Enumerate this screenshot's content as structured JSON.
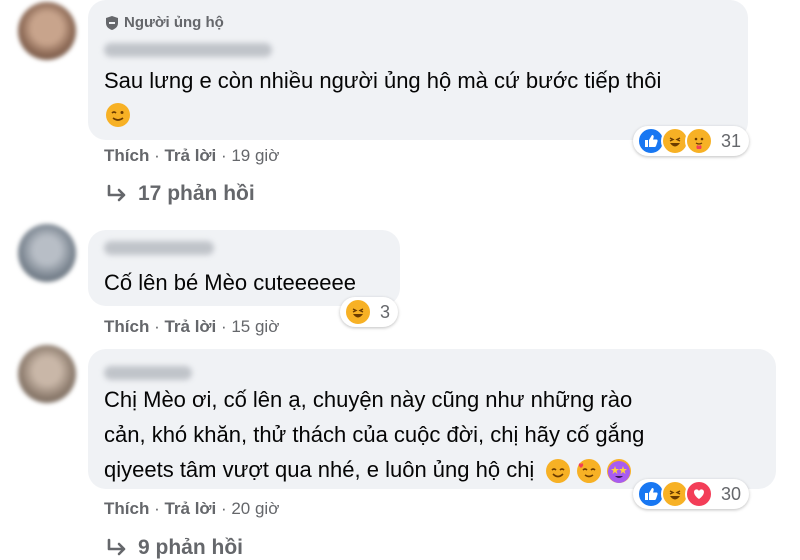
{
  "comments": [
    {
      "badge": "Người ủng hộ",
      "text_line1": "Sau lưng e còn nhiều người ủng hộ mà cứ bước tiếp thôi",
      "reaction_count": "31",
      "actions": {
        "like": "Thích",
        "sep1": " · ",
        "reply": "Trả lời",
        "sep2": " · ",
        "time": "19 giờ"
      },
      "replies": "17 phản hồi"
    },
    {
      "text": "Cố lên bé Mèo cuteeeeee",
      "reaction_count": "3",
      "actions": {
        "like": "Thích",
        "sep1": " · ",
        "reply": "Trả lời",
        "sep2": " · ",
        "time": "15 giờ"
      }
    },
    {
      "text_line1": "Chị Mèo ơi, cố lên ạ, chuyện này cũng như những rào",
      "text_line2": "cản, khó khăn, thử thách của cuộc đời, chị hãy cố gắng",
      "text_line3": "qiyeets tâm vượt qua nhé, e luôn ủng hộ chị",
      "reaction_count": "30",
      "actions": {
        "like": "Thích",
        "sep1": " · ",
        "reply": "Trả lời",
        "sep2": " · ",
        "time": "20 giờ"
      },
      "replies": "9 phản hồi"
    }
  ],
  "icons": {
    "badge": "shield-icon",
    "reply_arrow": "reply-arrow-icon",
    "reactions": [
      "like-icon",
      "haha-icon",
      "care-icon",
      "love-icon"
    ]
  },
  "colors": {
    "bubble": "#f0f2f5",
    "meta_text": "#65676b",
    "like": "#1877f2",
    "haha": "#f7b125",
    "love": "#f33e58"
  }
}
